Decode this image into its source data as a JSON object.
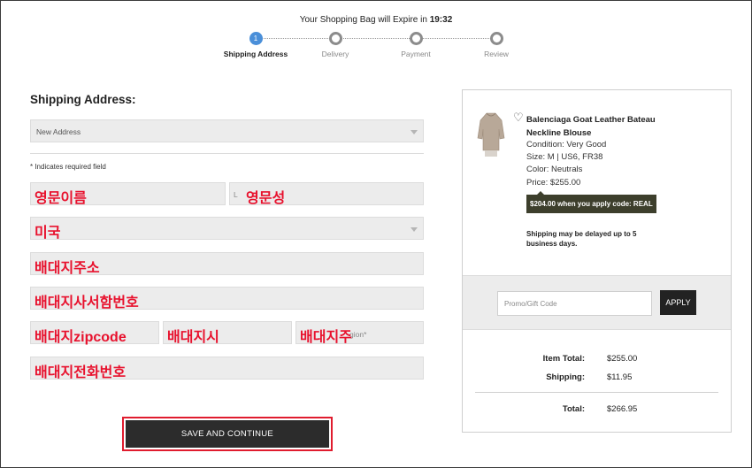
{
  "header": {
    "expire_prefix": "Your Shopping Bag will Expire in",
    "expire_time": "19:32"
  },
  "steps": [
    {
      "number": "1",
      "label": "Shipping Address",
      "active": true
    },
    {
      "number": "",
      "label": "Delivery",
      "active": false
    },
    {
      "number": "",
      "label": "Payment",
      "active": false
    },
    {
      "number": "",
      "label": "Review",
      "active": false
    }
  ],
  "shipping": {
    "title": "Shipping Address:",
    "address_select": "New Address",
    "required_note": "* Indicates required field",
    "first_name_annotation": "영문이름",
    "last_name_hint": "L",
    "last_name_annotation": "영문성",
    "country_annotation": "미국",
    "address1_annotation": "배대지주소",
    "address2_annotation": "배대지사서함번호",
    "zip_annotation": "배대지zipcode",
    "city_annotation": "배대지시",
    "state_hint": "gion*",
    "state_annotation": "배대지주",
    "phone_annotation": "배대지전화번호",
    "save_button": "SAVE AND CONTINUE"
  },
  "summary": {
    "product_name": "Balenciaga Goat Leather Bateau Neckline Blouse",
    "condition": "Condition: Very Good",
    "size": "Size: M | US6, FR38",
    "color": "Color: Neutrals",
    "price": "Price: $255.00",
    "promo_tag": "$204.00 when you apply code: REAL",
    "delay_note": "Shipping may be delayed up to 5 business days.",
    "promo_placeholder": "Promo/Gift Code",
    "apply_label": "APPLY",
    "item_total_label": "Item Total:",
    "item_total_value": "$255.00",
    "shipping_label": "Shipping:",
    "shipping_value": "$11.95",
    "total_label": "Total:",
    "total_value": "$266.95"
  },
  "colors": {
    "accent_step": "#4a8fd9",
    "annotation_red": "#e8112d",
    "button_dark": "#2c2c2c",
    "promo_tag_bg": "#3d3f2c"
  },
  "icons": [
    "heart-icon",
    "dropdown-caret-icon",
    "product-thumbnail"
  ]
}
